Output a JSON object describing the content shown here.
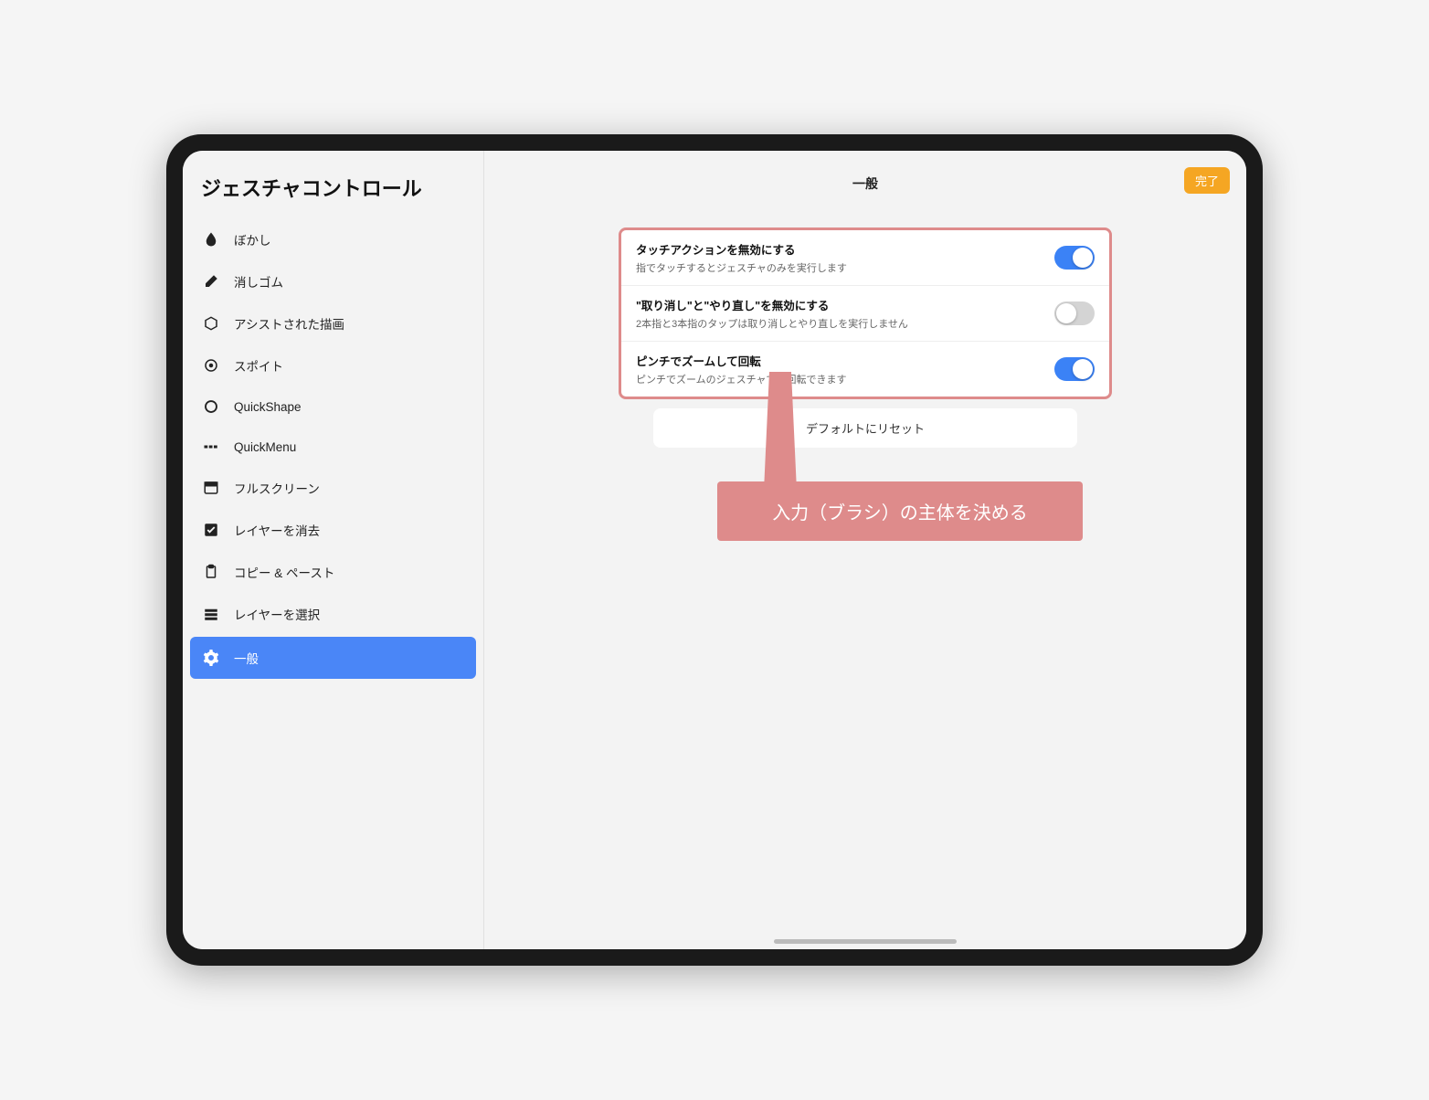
{
  "sidebar": {
    "title": "ジェスチャコントロール",
    "items": [
      {
        "label": "ぼかし",
        "icon": "blur"
      },
      {
        "label": "消しゴム",
        "icon": "eraser"
      },
      {
        "label": "アシストされた描画",
        "icon": "cube"
      },
      {
        "label": "スポイト",
        "icon": "eyedropper"
      },
      {
        "label": "QuickShape",
        "icon": "quickshape"
      },
      {
        "label": "QuickMenu",
        "icon": "quickmenu"
      },
      {
        "label": "フルスクリーン",
        "icon": "fullscreen"
      },
      {
        "label": "レイヤーを消去",
        "icon": "clearlayer"
      },
      {
        "label": "コピー & ペースト",
        "icon": "clipboard"
      },
      {
        "label": "レイヤーを選択",
        "icon": "selectlayer"
      },
      {
        "label": "一般",
        "icon": "gear",
        "selected": true
      }
    ]
  },
  "header": {
    "title": "一般",
    "done": "完了"
  },
  "settings": [
    {
      "label": "タッチアクションを無効にする",
      "desc": "指でタッチするとジェスチャのみを実行します",
      "on": true
    },
    {
      "label": "\"取り消し\"と\"やり直し\"を無効にする",
      "desc": "2本指と3本指のタップは取り消しとやり直しを実行しません",
      "on": false
    },
    {
      "label": "ピンチでズームして回転",
      "desc": "ピンチでズームのジェスチャでも回転できます",
      "on": true
    }
  ],
  "reset_label": "デフォルトにリセット",
  "callout_text": "入力（ブラシ）の主体を決める",
  "colors": {
    "accent": "#4a86f7",
    "callout": "#de8b8b",
    "done": "#f5a623",
    "switch_on": "#3b82f6"
  }
}
